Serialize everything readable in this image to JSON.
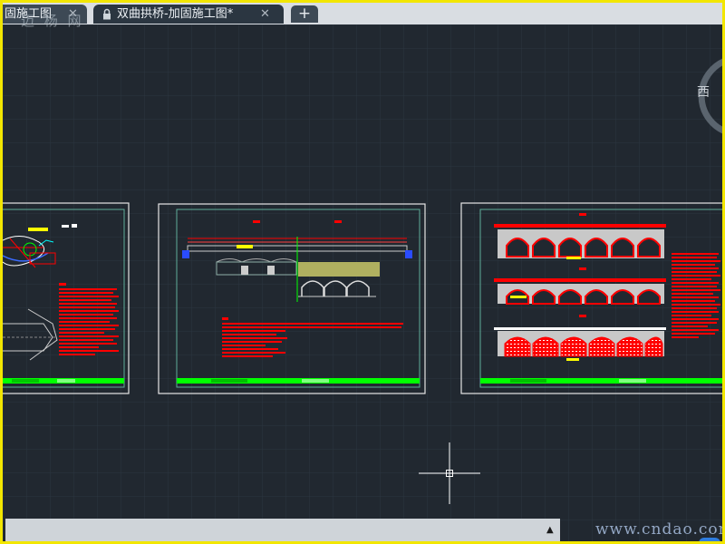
{
  "tabs": [
    {
      "label": "固施工图",
      "close": "✕",
      "active": false
    },
    {
      "label": "双曲拱桥-加固施工图*",
      "close": "✕",
      "active": true
    }
  ],
  "new_tab_label": "+",
  "watermark_top": "迈 杨 网",
  "compass": {
    "west_label": "西"
  },
  "watermark_bottom": "www.cndao.com",
  "command_line": {
    "expand_arrow": "▲"
  },
  "icons": {
    "lock": "lock-icon",
    "close": "close-icon",
    "plus": "plus-icon",
    "crosshair": "crosshair-cursor-icon",
    "viewcube": "viewcube-ring-icon",
    "help": "help-icon"
  },
  "colors": {
    "model_space_bg": "#212830",
    "grid_line": "#2c3640",
    "frame_border": "#f2e600",
    "sheet_border": "#e6e6e6",
    "inner_frame": "#5fae9a",
    "annotation_red": "#ff0000",
    "title_block_green": "#00ff00",
    "accent_yellow": "#ffff00",
    "accent_blue": "#3b6cff"
  }
}
